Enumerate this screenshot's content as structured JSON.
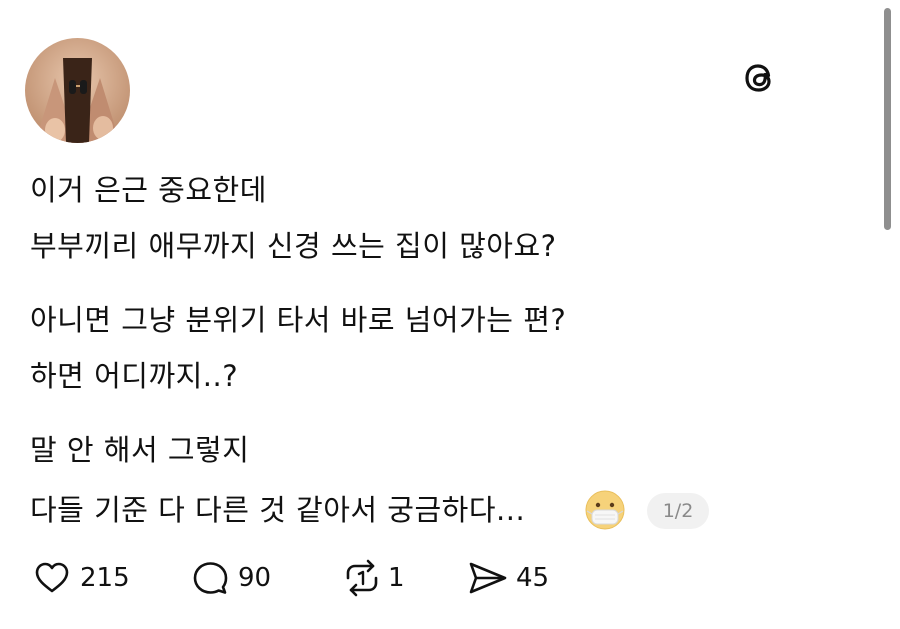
{
  "post": {
    "avatar_icon": "profile-photo",
    "app_icon": "threads-logo-icon",
    "lines": [
      "이거 은근 중요한데",
      "부부끼리 애무까지 신경 쓰는 집이 많아요?",
      "아니면 그냥 분위기 타서 바로 넘어가는 편?",
      "하면 어디까지..?",
      "말 안 해서 그렇지",
      "다들 기준 다 다른 것 같아서 궁금하다..."
    ],
    "emoji_icon": "face-with-medical-mask-emoji",
    "page_indicator": "1/2"
  },
  "actions": {
    "like": {
      "icon": "heart-icon",
      "count": "215"
    },
    "comment": {
      "icon": "comment-bubble-icon",
      "count": "90"
    },
    "repost": {
      "icon": "repost-icon",
      "count": "1"
    },
    "share": {
      "icon": "send-icon",
      "count": "45"
    }
  },
  "colors": {
    "text": "#111111",
    "muted": "#8a8a8a",
    "pill_bg": "#f1f1f1",
    "scrollbar": "#8f8f8f"
  }
}
